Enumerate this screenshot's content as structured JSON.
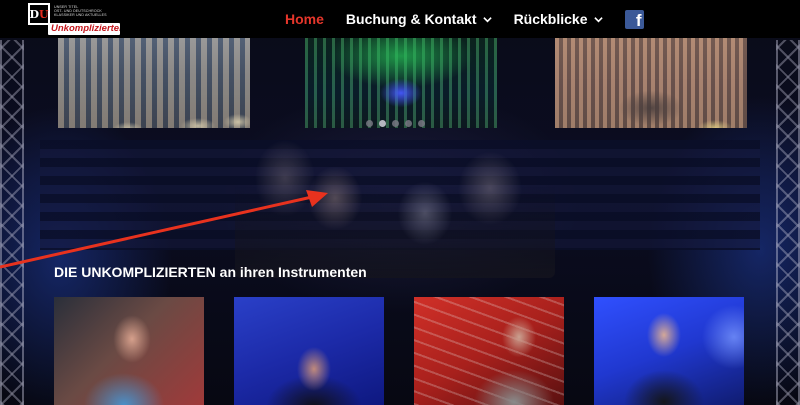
{
  "logo": {
    "mark_d": "D",
    "mark_u": "U",
    "small_line_1": "UNSER TITEL",
    "small_line_2": "OST- UND DEUTSCHROCK",
    "small_line_3": "KLASSIKER UND AKTUELLES",
    "wordmark": "Unkomplizierten"
  },
  "nav": {
    "home": "Home",
    "booking": "Buchung & Kontakt",
    "retro": "Rückblicke",
    "facebook_glyph": "f",
    "facebook_icon": "facebook-icon",
    "active_color": "#e5362b"
  },
  "slider": {
    "slide_count": 5,
    "active_index": 1
  },
  "section": {
    "title": "DIE UNKOMPLIZIERTEN an ihren Instrumenten"
  },
  "colors": {
    "accent_red": "#e5362b",
    "arrow_red": "#e8321e",
    "facebook_blue": "#3b5998"
  }
}
